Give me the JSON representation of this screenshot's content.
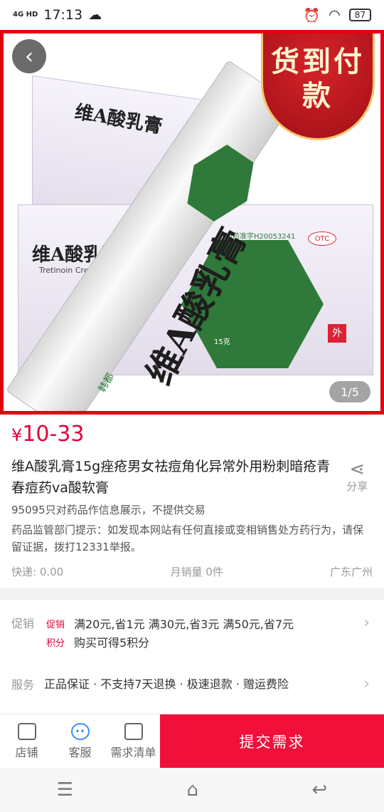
{
  "status_bar": {
    "network": "4G HD",
    "time": "17:13",
    "battery": "87"
  },
  "hero": {
    "badge": "货到付款",
    "counter": "1/5",
    "product_name_box": "维A酸乳膏",
    "product_name_tube": "维A酸乳膏",
    "otc": "OTC",
    "brand": "韩都",
    "approval": "国药准字H20053241",
    "english_name": "Tretinoin Cream",
    "spec": "15克",
    "side_mark": "外"
  },
  "product": {
    "price_currency": "¥",
    "price_range": "10-33",
    "title": "维A酸乳膏15g痤疮男女祛痘角化异常外用粉刺暗疮青春痘药va酸软膏",
    "share_label": "分享",
    "notice1": "95095只对药品作信息展示，不提供交易",
    "notice2": "药品监管部门提示：如发现本网站有任何直接或变相销售处方药行为，请保留证据，拨打12331举报。",
    "shipping": "快递: 0.00",
    "monthly_sales": "月销量 0件",
    "location": "广东广州"
  },
  "promotion": {
    "label": "促销",
    "tag1": "促销",
    "text1": "满20元,省1元 满30元,省3元 满50元,省7元",
    "tag2": "积分",
    "text2": "购买可得5积分"
  },
  "service": {
    "label": "服务",
    "text": "正品保证 · 不支持7天退换 · 极速退款 · 赠运费险"
  },
  "bottom_bar": {
    "store": "店铺",
    "customer_service": "客服",
    "request_list": "需求清单",
    "submit": "提交需求"
  },
  "colors": {
    "accent": "#e4003a",
    "submit_bg": "#f0103a",
    "hero_border": "#e60012"
  }
}
